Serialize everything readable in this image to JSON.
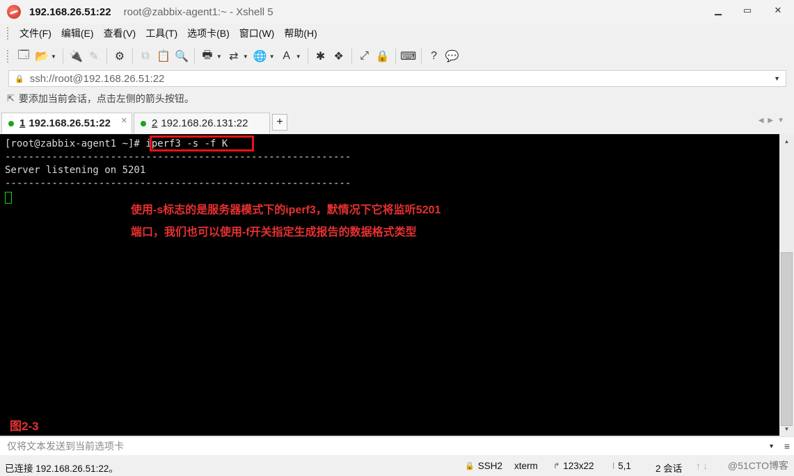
{
  "window": {
    "host": "192.168.26.51:22",
    "title": "root@zabbix-agent1:~ - Xshell 5",
    "controls": {
      "minimize": "▁",
      "maximize": "▭",
      "close": "✕"
    }
  },
  "menu": [
    "文件(F)",
    "编辑(E)",
    "查看(V)",
    "工具(T)",
    "选项卡(B)",
    "窗口(W)",
    "帮助(H)"
  ],
  "address": {
    "text": "ssh://root@192.168.26.51:22"
  },
  "hint": {
    "text": "要添加当前会话，点击左侧的箭头按钮。"
  },
  "tabs": [
    {
      "num": "1",
      "label": "192.168.26.51:22",
      "active": true
    },
    {
      "num": "2",
      "label": "192.168.26.131:22",
      "active": false
    }
  ],
  "terminal": {
    "lines": [
      "[root@zabbix-agent1 ~]# iperf3 -s -f K",
      "-----------------------------------------------------------",
      "Server listening on 5201",
      "-----------------------------------------------------------"
    ],
    "annotation": [
      "使用-s标志的是服务器模式下的iperf3，默情况下它将监听5201",
      "端口，我们也可以使用-f开关指定生成报告的数据格式类型"
    ],
    "figure_label": "图2-3"
  },
  "sendbar": {
    "placeholder": "仅将文本发送到当前选项卡"
  },
  "status": {
    "connection": "已连接 192.168.26.51:22。",
    "protocol": "SSH2",
    "term": "xterm",
    "size": "123x22",
    "cursor": "5,1",
    "sessions": "2 会话",
    "watermark": "@51CTO博客"
  }
}
